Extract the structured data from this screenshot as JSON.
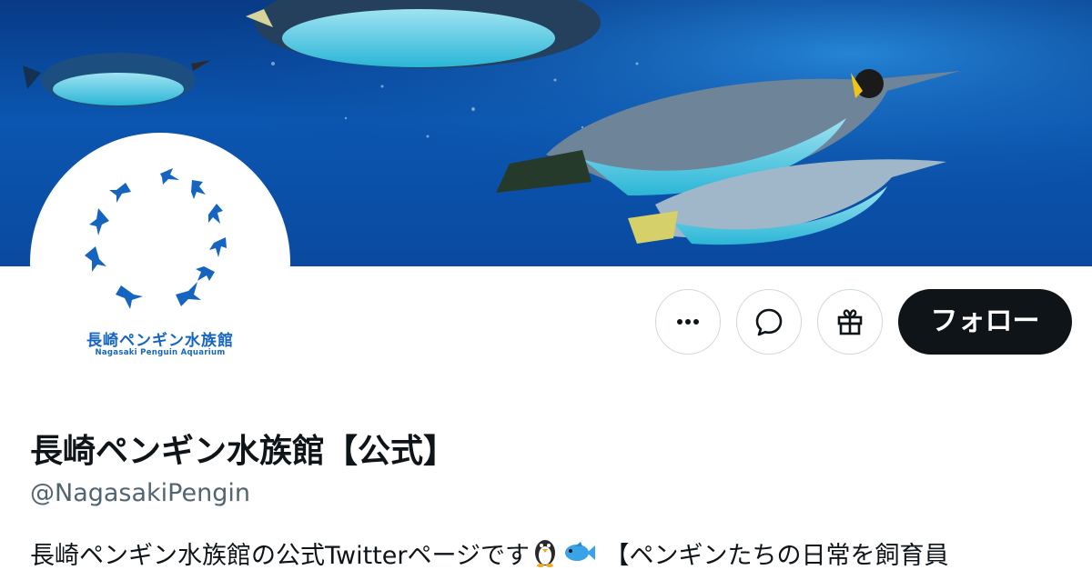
{
  "profile": {
    "display_name": "長崎ペンギン水族館【公式】",
    "handle": "@NagasakiPengin",
    "bio_text": "長崎ペンギン水族館の公式Twitterページです",
    "bio_emojis": [
      "penguin-emoji",
      "fish-emoji"
    ],
    "bio_continued": "【ペンギンたちの日常を飼育員"
  },
  "avatar": {
    "logo_jp": "長崎ペンギン水族館",
    "logo_en": "Nagasaki Penguin Aquarium"
  },
  "actions": {
    "more_icon": "more-horizontal-icon",
    "message_icon": "message-icon",
    "gift_icon": "gift-icon",
    "follow_label": "フォロー"
  },
  "colors": {
    "follow_bg": "#0f1419",
    "handle_text": "#536471",
    "logo_blue": "#1565c0",
    "banner_water": "#0b56b0"
  }
}
